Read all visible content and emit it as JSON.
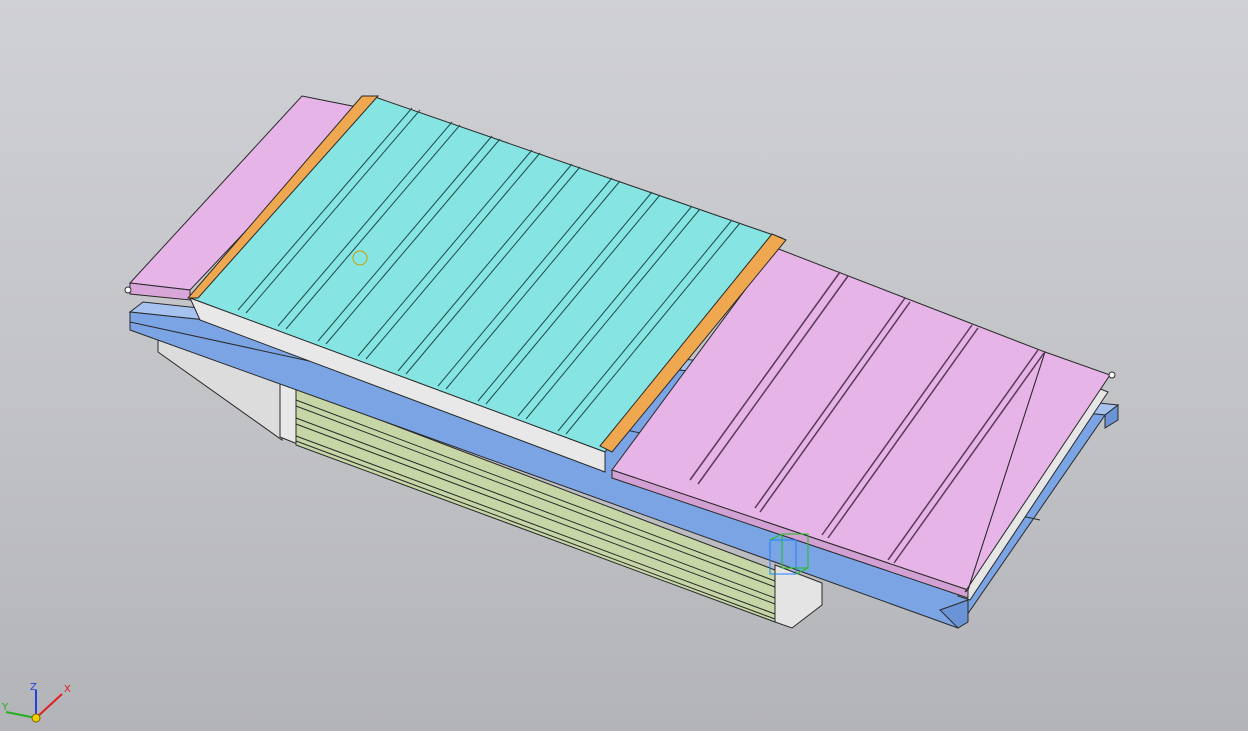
{
  "triad": {
    "x_label": "X",
    "y_label": "Y",
    "z_label": "Z"
  },
  "colors": {
    "background_top": "#d0d1d5",
    "background_bottom": "#b3b4b8",
    "pink_cover": "#e6b4e6",
    "cyan_table": "#86e4e2",
    "orange_strip": "#f0a850",
    "blue_rail": "#7aa4e4",
    "green_bellows": "#c6d6a6",
    "gray_housing": "#e2e2e2",
    "edge": "#2a2a2a",
    "axis_x": "#e02020",
    "axis_y": "#20b020",
    "axis_z": "#2040e0"
  }
}
